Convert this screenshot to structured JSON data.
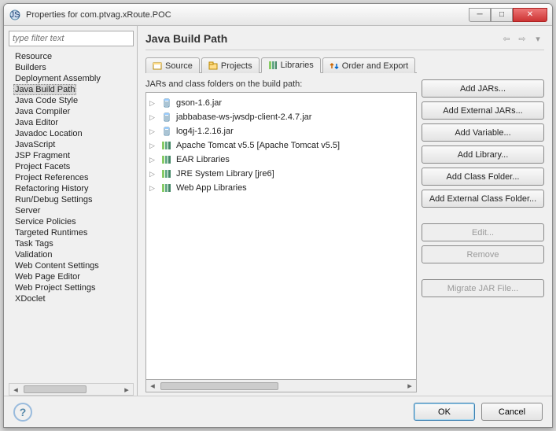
{
  "title": "Properties for com.ptvag.xRoute.POC",
  "filter_placeholder": "type filter text",
  "sidebar": {
    "items": [
      "Resource",
      "Builders",
      "Deployment Assembly",
      "Java Build Path",
      "Java Code Style",
      "Java Compiler",
      "Java Editor",
      "Javadoc Location",
      "JavaScript",
      "JSP Fragment",
      "Project Facets",
      "Project References",
      "Refactoring History",
      "Run/Debug Settings",
      "Server",
      "Service Policies",
      "Targeted Runtimes",
      "Task Tags",
      "Validation",
      "Web Content Settings",
      "Web Page Editor",
      "Web Project Settings",
      "XDoclet"
    ],
    "selected": "Java Build Path"
  },
  "main": {
    "heading": "Java Build Path",
    "tabs": [
      "Source",
      "Projects",
      "Libraries",
      "Order and Export"
    ],
    "active_tab": "Libraries",
    "desc": "JARs and class folders on the build path:",
    "entries": [
      {
        "icon": "jar",
        "label": "gson-1.6.jar"
      },
      {
        "icon": "jar",
        "label": "jabbabase-ws-jwsdp-client-2.4.7.jar"
      },
      {
        "icon": "jar",
        "label": "log4j-1.2.16.jar"
      },
      {
        "icon": "lib",
        "label": "Apache Tomcat v5.5 [Apache Tomcat v5.5]"
      },
      {
        "icon": "lib",
        "label": "EAR Libraries"
      },
      {
        "icon": "lib",
        "label": "JRE System Library [jre6]"
      },
      {
        "icon": "lib",
        "label": "Web App Libraries"
      }
    ],
    "buttons": {
      "add_jars": "Add JARs...",
      "add_ext_jars": "Add External JARs...",
      "add_var": "Add Variable...",
      "add_lib": "Add Library...",
      "add_class": "Add Class Folder...",
      "add_ext_class": "Add External Class Folder...",
      "edit": "Edit...",
      "remove": "Remove",
      "migrate": "Migrate JAR File..."
    }
  },
  "footer": {
    "ok": "OK",
    "cancel": "Cancel"
  }
}
